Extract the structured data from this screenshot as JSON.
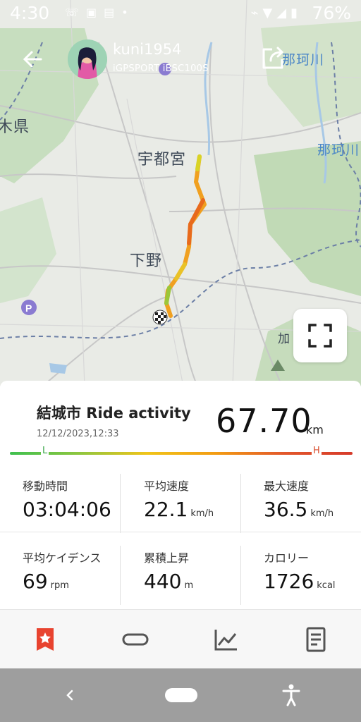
{
  "status_bar": {
    "time": "4:30",
    "battery_percent": "76%",
    "left_icons": [
      "wifi-calling-icon",
      "phone-app-icon",
      "notification-icon",
      "dot-icon"
    ],
    "right_icons": [
      "cast-icon",
      "wifi-icon",
      "signal-icon",
      "battery-icon"
    ]
  },
  "header": {
    "username": "kuni1954",
    "device": "iGPSPORT iBSC100S",
    "back_icon": "back-arrow-icon",
    "share_icon": "share-icon"
  },
  "map": {
    "labels": [
      {
        "text": "宇都宮",
        "style": "city"
      },
      {
        "text": "下野",
        "style": "city"
      },
      {
        "text": "木県",
        "style": "city"
      },
      {
        "text": "那珂川",
        "style": "river"
      },
      {
        "text": "那珂川",
        "style": "river"
      },
      {
        "text": "加",
        "style": "city"
      }
    ],
    "fullscreen_icon": "fullscreen-icon"
  },
  "activity": {
    "title": "結城市 Ride activity",
    "date": "12/12/2023,12:33",
    "distance": "67.70",
    "distance_unit": "km",
    "gradient_low": "L",
    "gradient_high": "H",
    "colors": {
      "low": "#3ec04f",
      "high": "#d63a2a",
      "accent": "#e8432f"
    }
  },
  "stats": [
    {
      "label": "移動時間",
      "value": "03:04:06",
      "unit": ""
    },
    {
      "label": "平均速度",
      "value": "22.1",
      "unit": "km/h"
    },
    {
      "label": "最大速度",
      "value": "36.5",
      "unit": "km/h"
    },
    {
      "label": "平均ケイデンス",
      "value": "69",
      "unit": "rpm"
    },
    {
      "label": "累積上昇",
      "value": "440",
      "unit": "m"
    },
    {
      "label": "カロリー",
      "value": "1726",
      "unit": "kcal"
    }
  ],
  "tabs": [
    {
      "icon": "bookmark-star-icon",
      "active": true
    },
    {
      "icon": "route-loop-icon",
      "active": false
    },
    {
      "icon": "chart-line-icon",
      "active": false
    },
    {
      "icon": "document-icon",
      "active": false
    }
  ],
  "navbar": {
    "icons": [
      "back-icon",
      "home-pill-icon",
      "accessibility-icon"
    ]
  }
}
